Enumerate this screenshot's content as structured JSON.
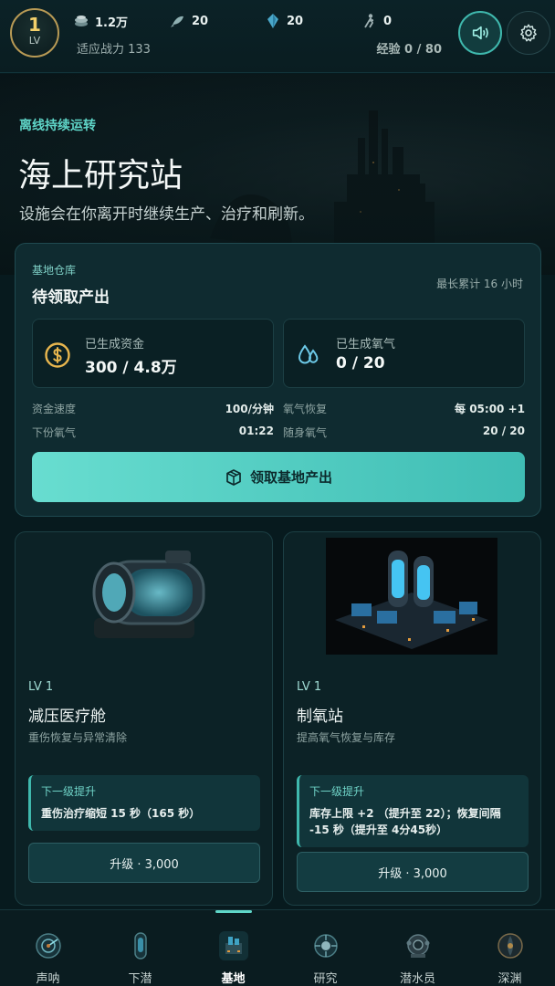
{
  "header": {
    "level": "1",
    "level_label": "LV",
    "resources": [
      {
        "icon": "coin-stack-icon",
        "value": "1.2万"
      },
      {
        "icon": "fish-icon",
        "value": "20"
      },
      {
        "icon": "crystal-icon",
        "value": "20"
      },
      {
        "icon": "diver-icon",
        "value": "0"
      }
    ],
    "power_text": "适应战力 133",
    "exp_text": "经验 0 / 80",
    "sound_icon": "speaker-icon",
    "settings_icon": "gear-icon"
  },
  "hero": {
    "eyebrow": "离线持续运转",
    "title": "海上研究站",
    "description": "设施会在你离开时继续生产、治疗和刷新。"
  },
  "warehouse": {
    "eyebrow": "基地仓库",
    "title": "待领取产出",
    "note": "最长累计 16 小时",
    "funds": {
      "icon": "dollar-coin-icon",
      "label": "已生成资金",
      "value": "300 / 4.8万"
    },
    "oxygen": {
      "icon": "water-drop-icon",
      "label": "已生成氧气",
      "value": "0 / 20"
    },
    "stats": [
      {
        "label": "资金速度",
        "value": "100/分钟"
      },
      {
        "label": "氧气恢复",
        "value": "每 05:00 +1"
      },
      {
        "label": "下份氧气",
        "value": "01:22"
      },
      {
        "label": "随身氧气",
        "value": "20 / 20"
      }
    ],
    "claim_label": "领取基地产出",
    "claim_icon": "box-icon"
  },
  "facilities": [
    {
      "level": "LV 1",
      "name": "减压医疗舱",
      "description": "重伤恢复与异常清除",
      "next_title": "下一级提升",
      "next_body": "重伤治疗缩短 15 秒（165 秒）",
      "upgrade_label": "升级 · 3,000"
    },
    {
      "level": "LV 1",
      "name": "制氧站",
      "description": "提高氧气恢复与库存",
      "next_title": "下一级提升",
      "next_body": "库存上限 +2 （提升至 22）；恢复间隔 -15 秒（提升至 4分45秒）",
      "upgrade_label": "升级 · 3,000"
    }
  ],
  "nav": {
    "active": "基地",
    "items": [
      {
        "label": "声呐",
        "icon": "sonar-icon"
      },
      {
        "label": "下潜",
        "icon": "submarine-icon"
      },
      {
        "label": "基地",
        "icon": "base-icon"
      },
      {
        "label": "研究",
        "icon": "research-icon"
      },
      {
        "label": "潜水员",
        "icon": "diver-helmet-icon"
      },
      {
        "label": "深渊",
        "icon": "abyss-icon"
      }
    ]
  },
  "colors": {
    "accent": "#5fd6c8",
    "gold": "#f2cf6a",
    "background": "#071a1e",
    "card": "#0f2b30"
  }
}
